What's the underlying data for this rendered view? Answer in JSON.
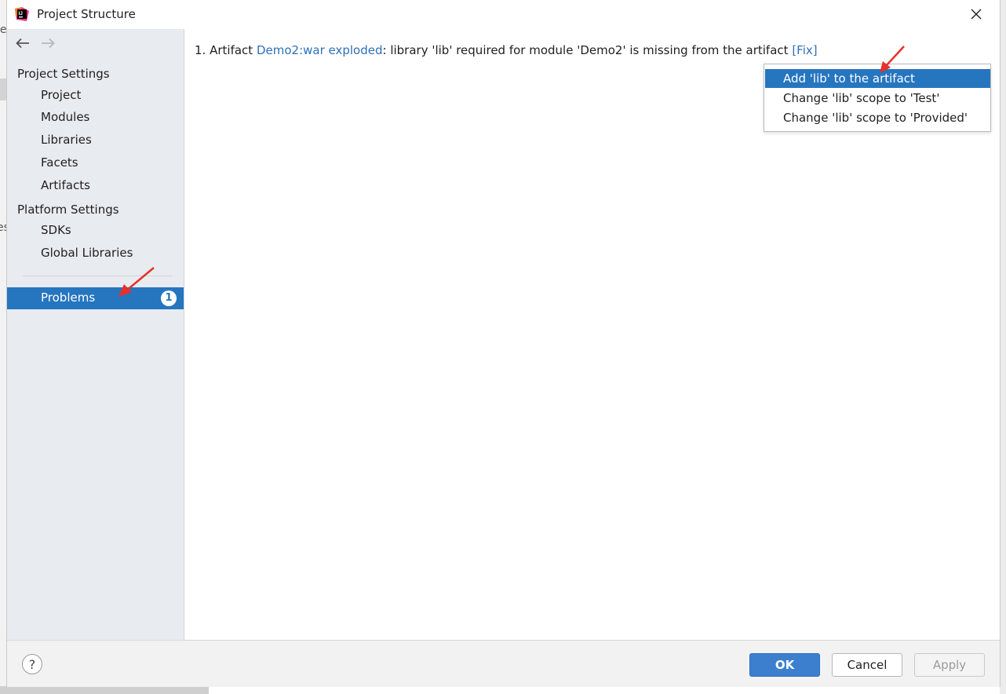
{
  "window": {
    "title": "Project Structure"
  },
  "background_text": {
    "fragment1": "le",
    "fragment2": "es"
  },
  "sidebar": {
    "project_settings_header": "Project Settings",
    "project_items": [
      "Project",
      "Modules",
      "Libraries",
      "Facets",
      "Artifacts"
    ],
    "platform_settings_header": "Platform Settings",
    "platform_items": [
      "SDKs",
      "Global Libraries"
    ],
    "problems": {
      "label": "Problems",
      "count": "1"
    }
  },
  "problem": {
    "index": "1.",
    "prefix": "Artifact",
    "artifact_link": "Demo2:war exploded",
    "message": ": library 'lib' required for module 'Demo2' is missing from the artifact",
    "fix_link": "[Fix]"
  },
  "fix_menu": {
    "items": [
      "Add 'lib' to the artifact",
      "Change 'lib' scope to 'Test'",
      "Change 'lib' scope to 'Provided'"
    ],
    "selected_index": 0
  },
  "footer": {
    "help": "?",
    "ok": "OK",
    "cancel": "Cancel",
    "apply": "Apply"
  },
  "colors": {
    "accent": "#2675bf",
    "link": "#2f6fba",
    "annotation_arrow": "#e8302a"
  }
}
